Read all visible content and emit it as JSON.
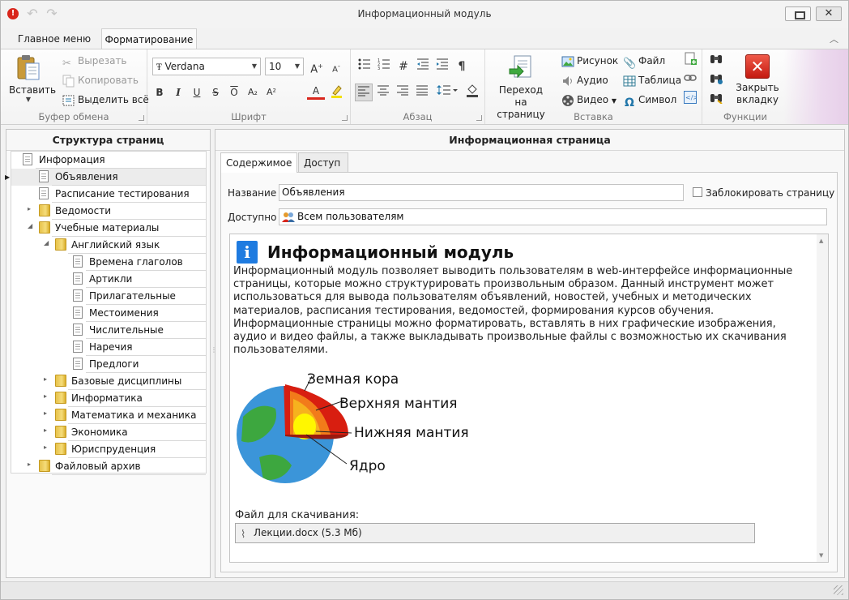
{
  "window": {
    "title": "Информационный модуль",
    "close_symbol": "✕"
  },
  "ribbon": {
    "tabs": [
      "Главное меню",
      "Форматирование"
    ],
    "active_tab": "Форматирование",
    "clipboard": {
      "caption": "Буфер обмена",
      "paste": "Вставить",
      "cut": "Вырезать",
      "copy": "Копировать",
      "select_all": "Выделить всё"
    },
    "font": {
      "caption": "Шрифт",
      "family": "Verdana",
      "size": "10",
      "bold": "B",
      "italic": "I",
      "underline": "U",
      "strike": "S",
      "overline": "O",
      "subscript": "A₂",
      "superscript": "A²",
      "font_color": "A",
      "grow": "A",
      "shrink": "A"
    },
    "paragraph": {
      "caption": "Абзац",
      "pilcrow": "¶"
    },
    "insert": {
      "caption": "Вставка",
      "goto_page_line1": "Переход на",
      "goto_page_line2": "страницу",
      "image": "Рисунок",
      "audio": "Аудио",
      "video": "Видео",
      "file": "Файл",
      "table": "Таблица",
      "symbol": "Символ",
      "symbol_glyph": "Ω"
    },
    "functions": {
      "caption": "Функции",
      "close_tab_line1": "Закрыть",
      "close_tab_line2": "вкладку"
    }
  },
  "left_panel": {
    "title": "Структура страниц",
    "tree": [
      {
        "label": "Информация",
        "type": "doc",
        "level": 0,
        "expander": ""
      },
      {
        "label": "Объявления",
        "type": "doc",
        "level": 1,
        "expander": "",
        "selected": true
      },
      {
        "label": "Расписание тестирования",
        "type": "doc",
        "level": 1,
        "expander": ""
      },
      {
        "label": "Ведомости",
        "type": "folder",
        "level": 1,
        "expander": "▸"
      },
      {
        "label": "Учебные материалы",
        "type": "folder",
        "level": 1,
        "expander": "◢"
      },
      {
        "label": "Английский язык",
        "type": "folder",
        "level": 2,
        "expander": "◢"
      },
      {
        "label": "Времена глаголов",
        "type": "doc",
        "level": 3,
        "expander": ""
      },
      {
        "label": "Артикли",
        "type": "doc",
        "level": 3,
        "expander": ""
      },
      {
        "label": "Прилагательные",
        "type": "doc",
        "level": 3,
        "expander": ""
      },
      {
        "label": "Местоимения",
        "type": "doc",
        "level": 3,
        "expander": ""
      },
      {
        "label": "Числительные",
        "type": "doc",
        "level": 3,
        "expander": ""
      },
      {
        "label": "Наречия",
        "type": "doc",
        "level": 3,
        "expander": ""
      },
      {
        "label": "Предлоги",
        "type": "doc",
        "level": 3,
        "expander": ""
      },
      {
        "label": "Базовые дисциплины",
        "type": "folder",
        "level": 2,
        "expander": "▸"
      },
      {
        "label": "Информатика",
        "type": "folder",
        "level": 2,
        "expander": "▸"
      },
      {
        "label": "Математика и механика",
        "type": "folder",
        "level": 2,
        "expander": "▸"
      },
      {
        "label": "Экономика",
        "type": "folder",
        "level": 2,
        "expander": "▸"
      },
      {
        "label": "Юриспруденция",
        "type": "folder",
        "level": 2,
        "expander": "▸"
      },
      {
        "label": "Файловый архив",
        "type": "folder",
        "level": 1,
        "expander": "▸"
      }
    ]
  },
  "right_panel": {
    "title": "Информационная страница",
    "tabs": [
      "Содержимое",
      "Доступ"
    ],
    "name_label": "Название",
    "name_value": "Объявления",
    "lock_label": "Заблокировать страницу",
    "access_label": "Доступно",
    "access_value": "Всем пользователям",
    "document": {
      "icon_letter": "i",
      "title": "Информационный модуль",
      "paragraph": "Информационный модуль позволяет выводить пользователям в web-интерфейсе информационные страницы, которые можно структурировать произвольным образом. Данный инструмент может использоваться для вывода пользователям объявлений, новостей, учебных и методических материалов, расписания тестирования, ведомостей, формирования курсов обучения. Информационные страницы можно форматировать, вставлять в них графические изображения, аудио и видео файлы, а также выкладывать произвольные файлы с возможностью их скачивания пользователями.",
      "diagram_labels": [
        "Земная кора",
        "Верхняя мантия",
        "Нижняя мантия",
        "Ядро"
      ],
      "download_caption": "Файл для скачивания:",
      "download_file": "Лекции.docx (5.3 Мб)"
    }
  },
  "colors": {
    "accent_red": "#d9261c",
    "info_blue": "#1e7be0",
    "folder_yellow": "#e7c24a"
  }
}
